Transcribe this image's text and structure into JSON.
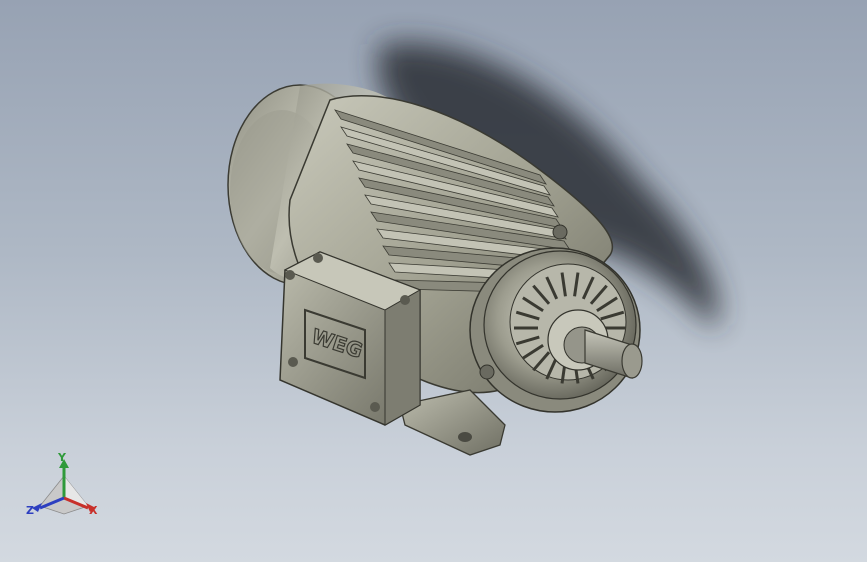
{
  "viewport": {
    "background_top": "#97a2b3",
    "background_bottom": "#d3d9e0"
  },
  "model": {
    "nameplate_logo_text": "WEG",
    "body_color": "#a9a99a",
    "shadow_color": "#2c2f36"
  },
  "triad": {
    "x_label": "X",
    "y_label": "Y",
    "z_label": "Z",
    "x_color": "#c8302a",
    "y_color": "#2f9a3a",
    "z_color": "#2d3fc0"
  }
}
